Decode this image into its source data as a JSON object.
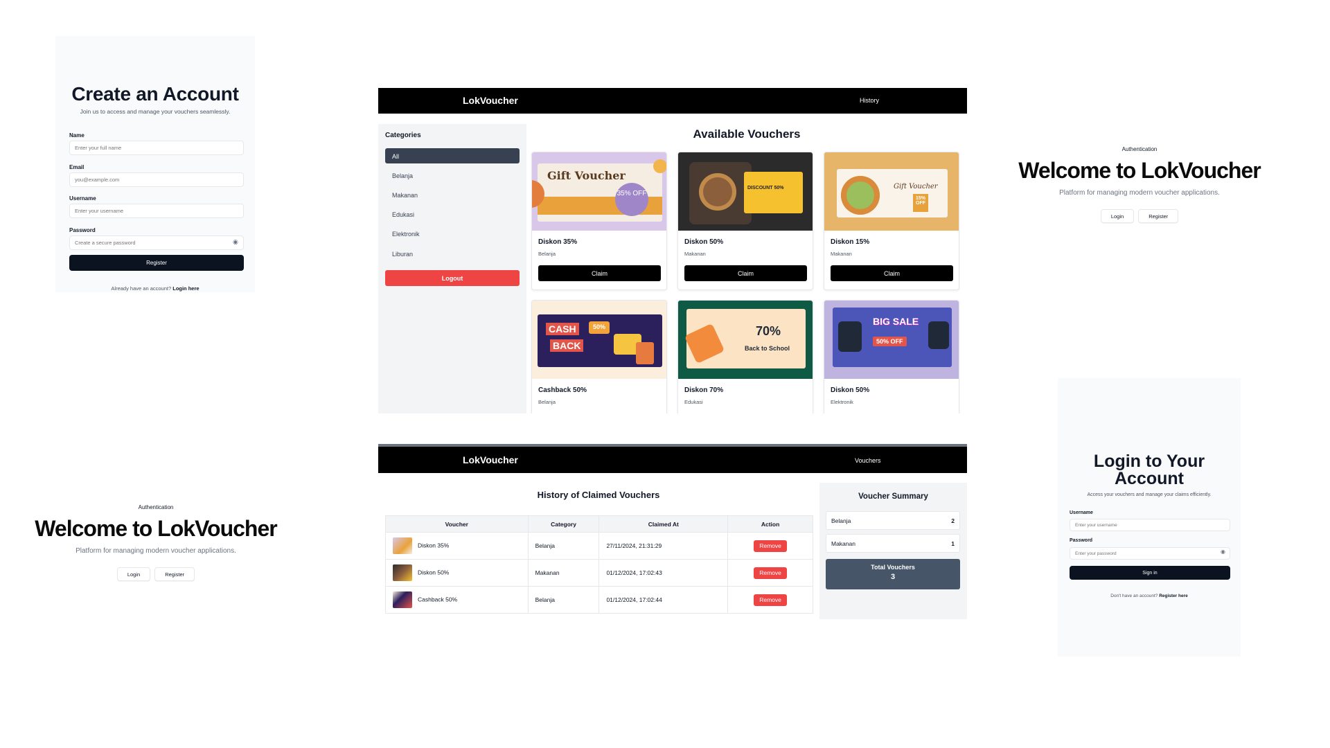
{
  "register": {
    "title": "Create an Account",
    "subtitle": "Join us to access and manage your vouchers seamlessly.",
    "name_label": "Name",
    "name_placeholder": "Enter your full name",
    "email_label": "Email",
    "email_placeholder": "you@example.com",
    "username_label": "Username",
    "username_placeholder": "Enter your username",
    "password_label": "Password",
    "password_placeholder": "Create a secure password",
    "submit": "Register",
    "footer_text": "Already have an account?",
    "footer_link": "Login here"
  },
  "welcome": {
    "eyebrow": "Authentication",
    "title": "Welcome to LokVoucher",
    "description": "Platform for managing modern voucher applications.",
    "login": "Login",
    "register": "Register"
  },
  "vouchers_page": {
    "brand": "LokVoucher",
    "nav_link": "History",
    "categories_title": "Categories",
    "categories": [
      "All",
      "Belanja",
      "Makanan",
      "Edukasi",
      "Elektronik",
      "Liburan"
    ],
    "logout": "Logout",
    "title": "Available Vouchers",
    "claim_label": "Claim",
    "cards": [
      {
        "name": "Diskon 35%",
        "category": "Belanja",
        "image_text_1": "Gift",
        "image_text_2": "Voucher",
        "image_badge": "35% OFF"
      },
      {
        "name": "Diskon 50%",
        "category": "Makanan",
        "image_text_1": "DISCOUNT 50%"
      },
      {
        "name": "Diskon 15%",
        "category": "Makanan",
        "image_text_1": "Gift Voucher",
        "image_badge": "15% OFF"
      },
      {
        "name": "Cashback 50%",
        "category": "Belanja",
        "image_text_1": "CASH",
        "image_text_2": "BACK",
        "image_badge": "50%"
      },
      {
        "name": "Diskon 70%",
        "category": "Edukasi",
        "image_text_1": "70%",
        "image_text_2": "Back to School"
      },
      {
        "name": "Diskon 50%",
        "category": "Elektronik",
        "image_text_1": "BIG SALE",
        "image_text_2": "50% OFF"
      }
    ]
  },
  "history_page": {
    "brand": "LokVoucher",
    "nav_link": "Vouchers",
    "title": "History of Claimed Vouchers",
    "columns": [
      "Voucher",
      "Category",
      "Claimed At",
      "Action"
    ],
    "rows": [
      {
        "voucher": "Diskon 35%",
        "category": "Belanja",
        "claimed_at": "27/11/2024, 21:31:29",
        "action": "Remove",
        "thumb_color": "#c4a3d6"
      },
      {
        "voucher": "Diskon 50%",
        "category": "Makanan",
        "claimed_at": "01/12/2024, 17:02:43",
        "action": "Remove",
        "thumb_color": "#3b3030"
      },
      {
        "voucher": "Cashback 50%",
        "category": "Belanja",
        "claimed_at": "01/12/2024, 17:02:44",
        "action": "Remove",
        "thumb_color": "#2e1f66"
      }
    ],
    "summary_title": "Voucher Summary",
    "summary": [
      {
        "category": "Belanja",
        "count": "2"
      },
      {
        "category": "Makanan",
        "count": "1"
      }
    ],
    "total_label": "Total Vouchers",
    "total_value": "3"
  },
  "login": {
    "title_line1": "Login to Your",
    "title_line2": "Account",
    "subtitle": "Access your vouchers and manage your claims efficiently.",
    "username_label": "Username",
    "username_placeholder": "Enter your username",
    "password_label": "Password",
    "password_placeholder": "Enter your password",
    "submit": "Sign in",
    "footer_text": "Don't have an account?",
    "footer_link": "Register here"
  },
  "colors": {
    "nav_bg": "#000000",
    "danger": "#ef4444",
    "primary_dark": "#0b1220",
    "summary_total": "#475569"
  },
  "icons": [
    "eye-icon"
  ]
}
